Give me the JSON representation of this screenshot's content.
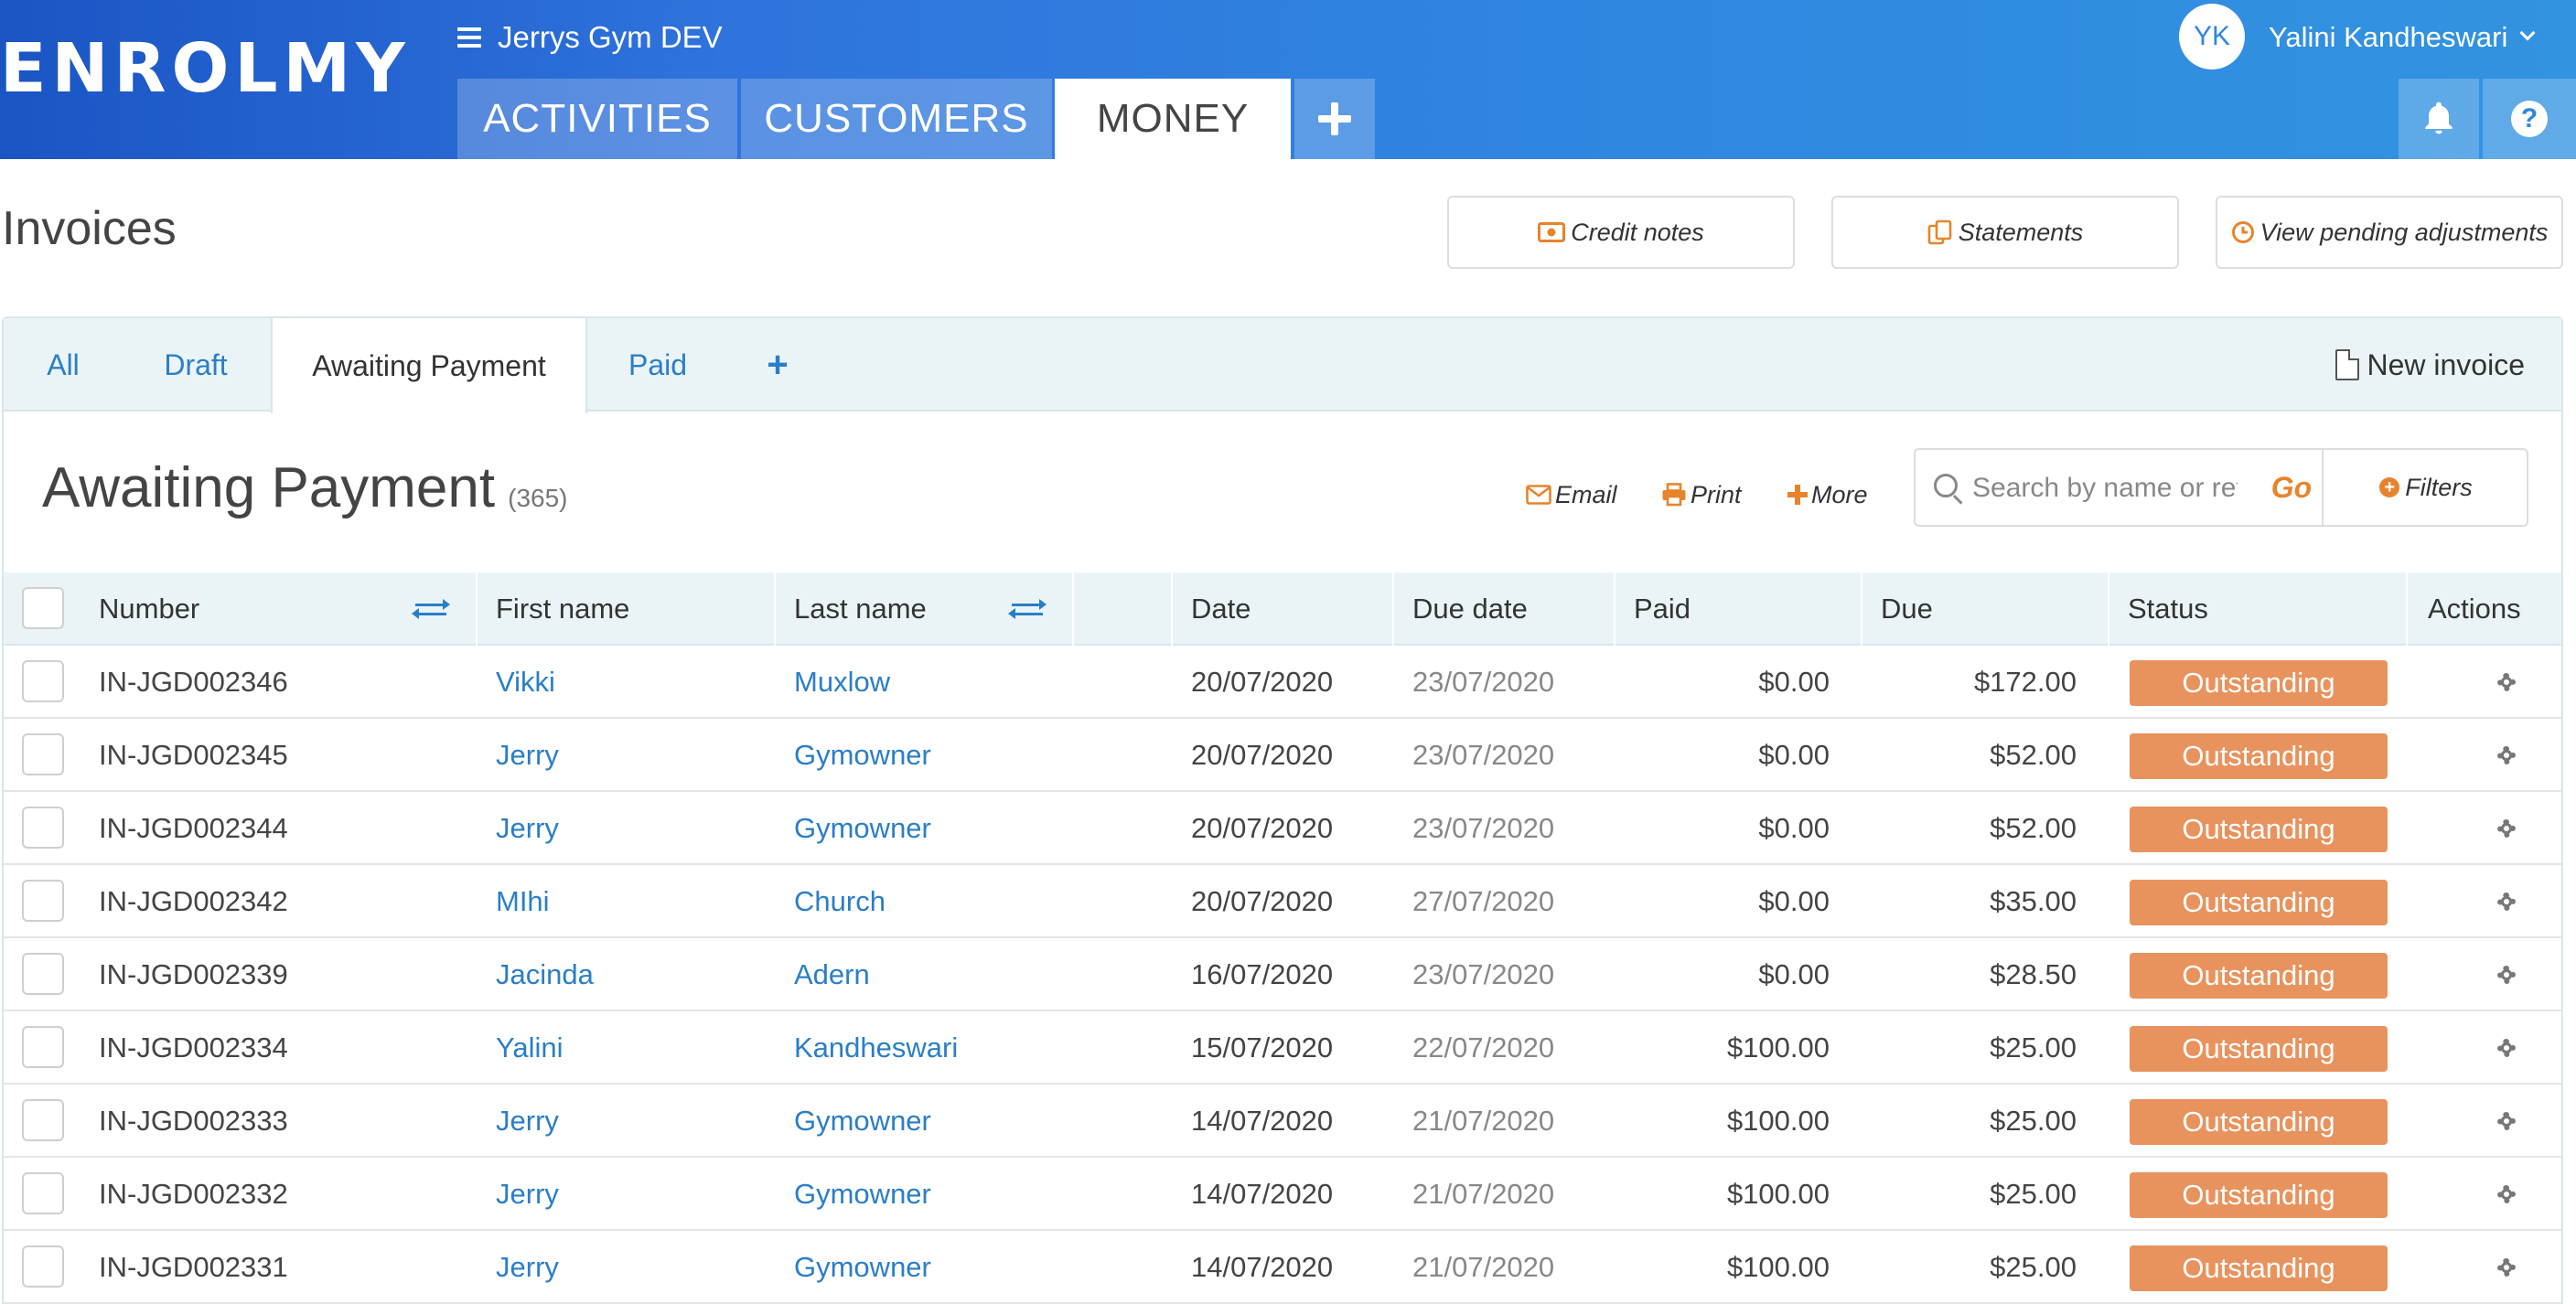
{
  "header": {
    "logo": "ENROLMY",
    "org_name": "Jerrys Gym DEV",
    "tabs": [
      {
        "label": "ACTIVITIES"
      },
      {
        "label": "CUSTOMERS"
      },
      {
        "label": "MONEY"
      }
    ],
    "user": {
      "initials": "YK",
      "name": "Yalini Kandheswari"
    },
    "help_glyph": "?"
  },
  "page": {
    "title": "Invoices",
    "actions": {
      "credit_notes": "Credit notes",
      "statements": "Statements",
      "pending_adjustments": "View pending adjustments"
    }
  },
  "subtabs": {
    "all": "All",
    "draft": "Draft",
    "awaiting": "Awaiting Payment",
    "paid": "Paid",
    "add": "+",
    "new_invoice": "New invoice"
  },
  "section": {
    "title": "Awaiting Payment",
    "count": "(365)",
    "email": "Email",
    "print": "Print",
    "more": "More",
    "search_placeholder": "Search by name or ref",
    "go": "Go",
    "filters": "Filters"
  },
  "table": {
    "columns": {
      "number": "Number",
      "first_name": "First name",
      "last_name": "Last name",
      "date": "Date",
      "due_date": "Due date",
      "paid": "Paid",
      "due": "Due",
      "status": "Status",
      "actions": "Actions"
    },
    "rows": [
      {
        "number": "IN-JGD002346",
        "first": "Vikki",
        "last": "Muxlow",
        "date": "20/07/2020",
        "due_date": "23/07/2020",
        "paid": "$0.00",
        "due": "$172.00",
        "status": "Outstanding"
      },
      {
        "number": "IN-JGD002345",
        "first": "Jerry",
        "last": "Gymowner",
        "date": "20/07/2020",
        "due_date": "23/07/2020",
        "paid": "$0.00",
        "due": "$52.00",
        "status": "Outstanding"
      },
      {
        "number": "IN-JGD002344",
        "first": "Jerry",
        "last": "Gymowner",
        "date": "20/07/2020",
        "due_date": "23/07/2020",
        "paid": "$0.00",
        "due": "$52.00",
        "status": "Outstanding"
      },
      {
        "number": "IN-JGD002342",
        "first": "MIhi",
        "last": "Church",
        "date": "20/07/2020",
        "due_date": "27/07/2020",
        "paid": "$0.00",
        "due": "$35.00",
        "status": "Outstanding"
      },
      {
        "number": "IN-JGD002339",
        "first": "Jacinda",
        "last": "Adern",
        "date": "16/07/2020",
        "due_date": "23/07/2020",
        "paid": "$0.00",
        "due": "$28.50",
        "status": "Outstanding"
      },
      {
        "number": "IN-JGD002334",
        "first": "Yalini",
        "last": "Kandheswari",
        "date": "15/07/2020",
        "due_date": "22/07/2020",
        "paid": "$100.00",
        "due": "$25.00",
        "status": "Outstanding"
      },
      {
        "number": "IN-JGD002333",
        "first": "Jerry",
        "last": "Gymowner",
        "date": "14/07/2020",
        "due_date": "21/07/2020",
        "paid": "$100.00",
        "due": "$25.00",
        "status": "Outstanding"
      },
      {
        "number": "IN-JGD002332",
        "first": "Jerry",
        "last": "Gymowner",
        "date": "14/07/2020",
        "due_date": "21/07/2020",
        "paid": "$100.00",
        "due": "$25.00",
        "status": "Outstanding"
      },
      {
        "number": "IN-JGD002331",
        "first": "Jerry",
        "last": "Gymowner",
        "date": "14/07/2020",
        "due_date": "21/07/2020",
        "paid": "$100.00",
        "due": "$25.00",
        "status": "Outstanding"
      }
    ]
  },
  "colors": {
    "header_blue": "#2f86e0",
    "link_blue": "#2a7ec8",
    "accent_orange": "#e8832c",
    "status_outstanding": "#e8935e"
  }
}
